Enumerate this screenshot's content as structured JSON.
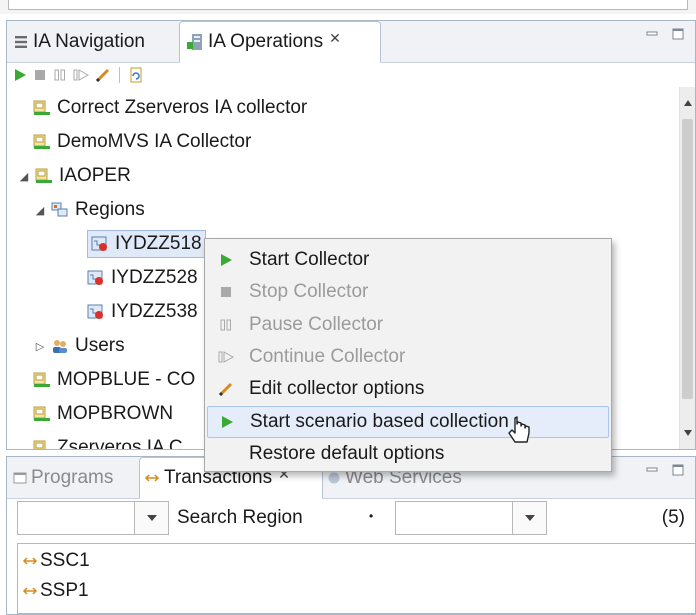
{
  "top_tabs": [
    {
      "label": "IA Navigation",
      "active": false
    },
    {
      "label": "IA Operations",
      "active": true,
      "close": "✕"
    }
  ],
  "toolbar": {
    "icons": [
      "play-icon",
      "stop-icon",
      "pause-icon",
      "continue-icon",
      "pencil-icon",
      "restore-icon"
    ]
  },
  "tree": {
    "rows": [
      {
        "label": "Correct Zserveros IA collector",
        "level": 0,
        "icon": "server-icon"
      },
      {
        "label": "DemoMVS IA Collector",
        "level": 0,
        "icon": "server-icon"
      },
      {
        "label": "IAOPER",
        "level": 0,
        "icon": "server-icon",
        "expander": "◢"
      },
      {
        "label": "Regions",
        "level": 1,
        "icon": "regions-icon",
        "expander": "◢"
      },
      {
        "label": "IYDZZ518",
        "level": 2,
        "icon": "region-stopped-icon",
        "selected": true
      },
      {
        "label": "IYDZZ528",
        "level": 2,
        "icon": "region-stopped-icon"
      },
      {
        "label": "IYDZZ538",
        "level": 2,
        "icon": "region-stopped-icon"
      },
      {
        "label": "Users",
        "level": 1,
        "icon": "users-icon",
        "expander": "▷"
      },
      {
        "label": "MOPBLUE  - CO",
        "level": 0,
        "icon": "server-icon"
      },
      {
        "label": "MOPBROWN",
        "level": 0,
        "icon": "server-icon"
      },
      {
        "label": "Zserveros IA C",
        "level": 0,
        "icon": "server-icon"
      }
    ]
  },
  "context_menu": {
    "items": [
      {
        "label": "Start Collector",
        "icon": "play-icon",
        "enabled": true
      },
      {
        "label": "Stop Collector",
        "icon": "stop-icon",
        "enabled": false
      },
      {
        "label": "Pause Collector",
        "icon": "pause-icon",
        "enabled": false
      },
      {
        "label": "Continue Collector",
        "icon": "continue-icon",
        "enabled": false
      },
      {
        "label": "Edit collector options",
        "icon": "pencil-icon",
        "enabled": true
      },
      {
        "label": "Start scenario based collection",
        "icon": "play-icon",
        "enabled": true,
        "hovered": true
      },
      {
        "label": "Restore default options",
        "icon": "",
        "enabled": true
      }
    ]
  },
  "bottom_tabs": [
    {
      "label": "Programs",
      "active": false
    },
    {
      "label": "Transactions",
      "active": true,
      "close": "✕"
    },
    {
      "label": "Web Services",
      "active": false
    }
  ],
  "filter": {
    "search_label": "Search Region",
    "separator": "•",
    "count": "(5)"
  },
  "transactions": [
    "SSC1",
    "SSP1"
  ],
  "colors": {
    "play_green": "#3aaa35",
    "selection_bg": "#dfe9f8",
    "menu_bg": "#f2f2f2",
    "menu_hover": "#e4edf9",
    "tab_bar": "#f0f2f6"
  }
}
